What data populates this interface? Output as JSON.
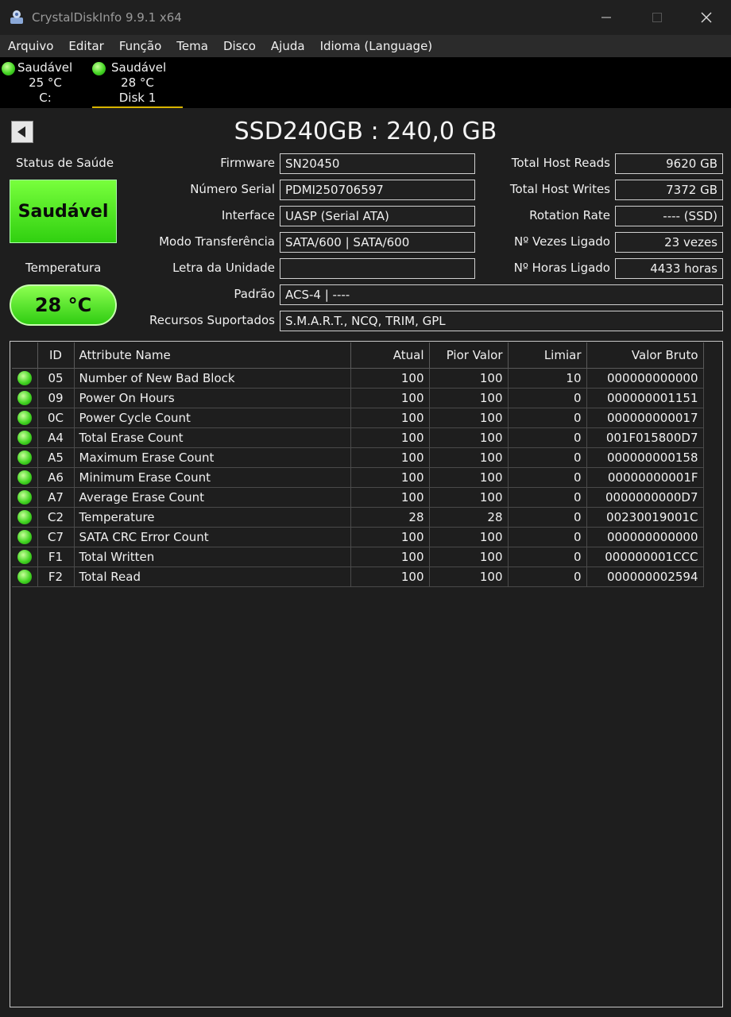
{
  "window": {
    "title": "CrystalDiskInfo 9.9.1 x64"
  },
  "menu": [
    "Arquivo",
    "Editar",
    "Função",
    "Tema",
    "Disco",
    "Ajuda",
    "Idioma (Language)"
  ],
  "disks": [
    {
      "status": "Saudável",
      "temp": "25 °C",
      "name": "C:"
    },
    {
      "status": "Saudável",
      "temp": "28 °C",
      "name": "Disk 1"
    }
  ],
  "drive": {
    "title": "SSD240GB : 240,0 GB",
    "health_label": "Status de Saúde",
    "health_value": "Saudável",
    "temp_label": "Temperatura",
    "temp_value": "28 °C"
  },
  "fields": {
    "firmware": {
      "label": "Firmware",
      "value": "SN20450"
    },
    "serial": {
      "label": "Número Serial",
      "value": "PDMI250706597"
    },
    "interface": {
      "label": "Interface",
      "value": "UASP (Serial ATA)"
    },
    "transfer": {
      "label": "Modo Transferência",
      "value": "SATA/600 | SATA/600"
    },
    "letter": {
      "label": "Letra da Unidade",
      "value": ""
    },
    "standard": {
      "label": "Padrão",
      "value": "ACS-4 | ----"
    },
    "features": {
      "label": "Recursos Suportados",
      "value": "S.M.A.R.T., NCQ, TRIM, GPL"
    },
    "host_reads": {
      "label": "Total Host Reads",
      "value": "9620 GB"
    },
    "host_writes": {
      "label": "Total Host Writes",
      "value": "7372 GB"
    },
    "rotation": {
      "label": "Rotation Rate",
      "value": "---- (SSD)"
    },
    "power_count": {
      "label": "Nº Vezes Ligado",
      "value": "23 vezes"
    },
    "power_hours": {
      "label": "Nº Horas Ligado",
      "value": "4433 horas"
    }
  },
  "table": {
    "headers": [
      "ID",
      "Attribute Name",
      "Atual",
      "Pior Valor",
      "Limiar",
      "Valor Bruto"
    ],
    "rows": [
      {
        "id": "05",
        "name": "Number of New Bad Block",
        "current": "100",
        "worst": "100",
        "threshold": "10",
        "raw": "000000000000"
      },
      {
        "id": "09",
        "name": "Power On Hours",
        "current": "100",
        "worst": "100",
        "threshold": "0",
        "raw": "000000001151"
      },
      {
        "id": "0C",
        "name": "Power Cycle Count",
        "current": "100",
        "worst": "100",
        "threshold": "0",
        "raw": "000000000017"
      },
      {
        "id": "A4",
        "name": "Total Erase Count",
        "current": "100",
        "worst": "100",
        "threshold": "0",
        "raw": "001F015800D7"
      },
      {
        "id": "A5",
        "name": "Maximum Erase Count",
        "current": "100",
        "worst": "100",
        "threshold": "0",
        "raw": "000000000158"
      },
      {
        "id": "A6",
        "name": "Minimum Erase Count",
        "current": "100",
        "worst": "100",
        "threshold": "0",
        "raw": "00000000001F"
      },
      {
        "id": "A7",
        "name": "Average Erase Count",
        "current": "100",
        "worst": "100",
        "threshold": "0",
        "raw": "0000000000D7"
      },
      {
        "id": "C2",
        "name": "Temperature",
        "current": "28",
        "worst": "28",
        "threshold": "0",
        "raw": "00230019001C"
      },
      {
        "id": "C7",
        "name": "SATA CRC Error Count",
        "current": "100",
        "worst": "100",
        "threshold": "0",
        "raw": "000000000000"
      },
      {
        "id": "F1",
        "name": "Total Written",
        "current": "100",
        "worst": "100",
        "threshold": "0",
        "raw": "000000001CCC"
      },
      {
        "id": "F2",
        "name": "Total Read",
        "current": "100",
        "worst": "100",
        "threshold": "0",
        "raw": "000000002594"
      }
    ]
  },
  "colors": {
    "good": "#44d623",
    "background": "#1e1e1e",
    "tab_underline": "#d8b400"
  }
}
